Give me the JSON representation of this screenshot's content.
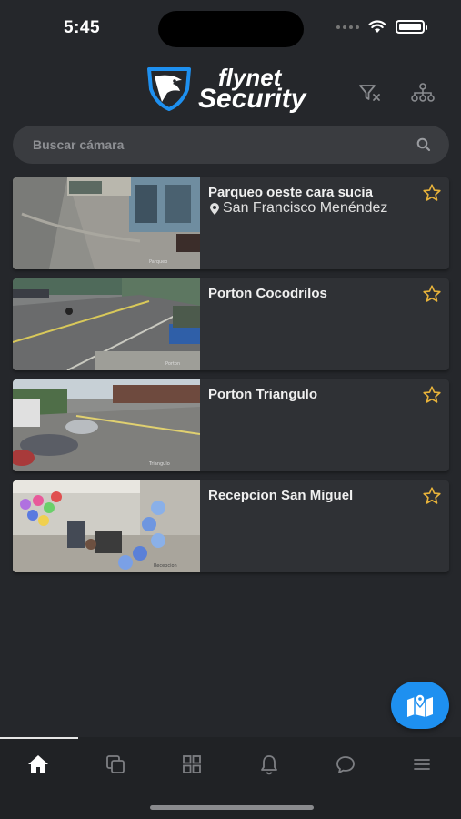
{
  "status_bar": {
    "time": "5:45",
    "battery_level": 1.0
  },
  "header": {
    "logo_line1": "flynet",
    "logo_line2": "Security",
    "filter_icon": "filter-clear-icon",
    "hierarchy_icon": "sitemap-icon"
  },
  "search": {
    "placeholder": "Buscar cámara",
    "value": ""
  },
  "cameras": [
    {
      "title": "Parqueo oeste cara sucia",
      "location": "San Francisco Menéndez",
      "favorite": false
    },
    {
      "title": "Porton Cocodrilos",
      "favorite": false
    },
    {
      "title": "Porton Triangulo",
      "favorite": false
    },
    {
      "title": "Recepcion San Miguel",
      "favorite": false
    }
  ],
  "fab": {
    "icon": "map-marker-icon"
  },
  "tabs": [
    {
      "name": "home",
      "icon": "home-icon",
      "active": true
    },
    {
      "name": "views",
      "icon": "copy-icon",
      "active": false
    },
    {
      "name": "grid",
      "icon": "grid-icon",
      "active": false
    },
    {
      "name": "alerts",
      "icon": "bell-icon",
      "active": false
    },
    {
      "name": "chat",
      "icon": "chat-icon",
      "active": false
    },
    {
      "name": "menu",
      "icon": "menu-icon",
      "active": false
    }
  ],
  "colors": {
    "background": "#25272b",
    "card": "#2f3135",
    "accent": "#1e90f0",
    "star": "#e8b33a",
    "logo": "#1e90f0"
  }
}
